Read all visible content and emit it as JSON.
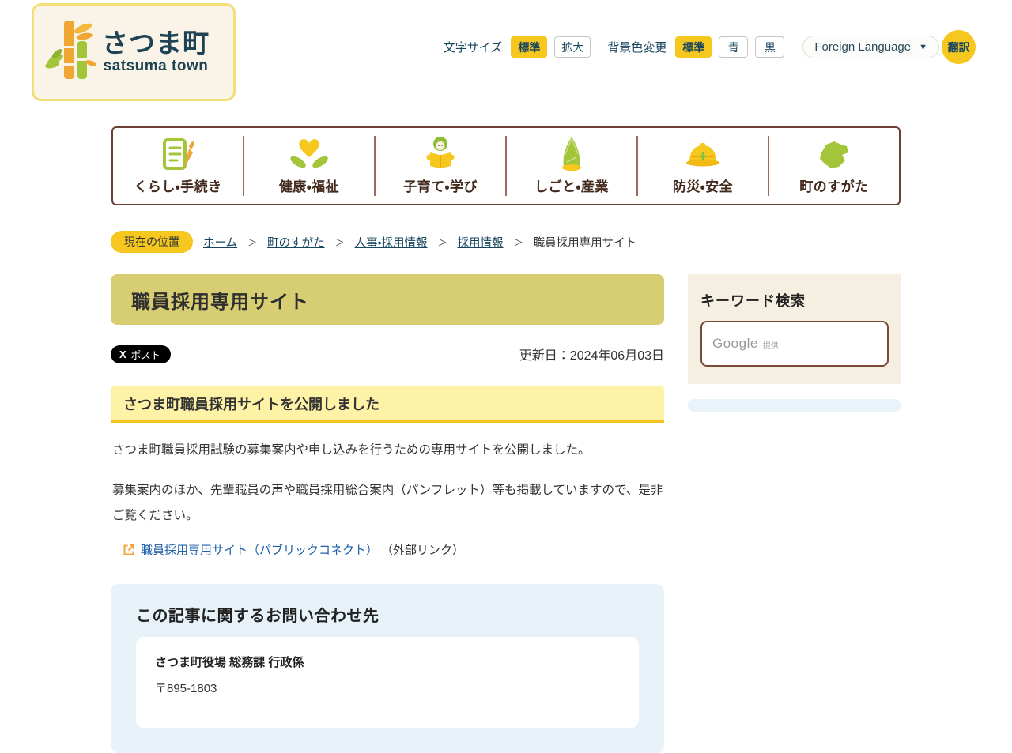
{
  "header": {
    "logo": {
      "title": "さつま町",
      "subtitle": "satsuma town"
    },
    "font_size": {
      "label": "文字サイズ",
      "options": [
        {
          "label": "標準",
          "active": true
        },
        {
          "label": "拡大",
          "active": false
        }
      ]
    },
    "bg_color": {
      "label": "背景色変更",
      "options": [
        {
          "label": "標準",
          "active": true
        },
        {
          "label": "青",
          "active": false
        },
        {
          "label": "黒",
          "active": false
        }
      ]
    },
    "language": {
      "label": "Foreign Language",
      "arrow": "▼",
      "translate": "翻訳"
    }
  },
  "nav": {
    "items": [
      {
        "label": "くらし・手続き",
        "icon": "document-pen-icon"
      },
      {
        "label": "健康・福祉",
        "icon": "heart-hands-icon"
      },
      {
        "label": "子育て・学び",
        "icon": "child-reading-icon"
      },
      {
        "label": "しごと・産業",
        "icon": "bamboo-shoot-icon"
      },
      {
        "label": "防災・安全",
        "icon": "helmet-icon"
      },
      {
        "label": "町のすがた",
        "icon": "town-map-icon"
      }
    ]
  },
  "breadcrumb": {
    "label": "現在の位置",
    "separator": "＞",
    "items": [
      {
        "text": "ホーム",
        "link": true
      },
      {
        "text": "町のすがた",
        "link": true
      },
      {
        "text": "人事・採用情報",
        "link": true
      },
      {
        "text": "採用情報",
        "link": true
      },
      {
        "text": "職員採用専用サイト",
        "link": false
      }
    ]
  },
  "page": {
    "title": "職員採用専用サイト",
    "share": {
      "icon_text": "X",
      "label": "ポスト"
    },
    "updated": "更新日：2024年06月03日"
  },
  "sidebar": {
    "search_title": "キーワード検索",
    "google": "Google",
    "provided": "提供"
  },
  "article": {
    "section_title": "さつま町職員採用サイトを公開しました",
    "paragraphs": [
      "さつま町職員採用試験の募集案内や申し込みを行うための専用サイトを公開しました。",
      "募集案内のほか、先輩職員の声や職員採用総合案内（パンフレット）等も掲載していますので、是非ご覧ください。"
    ],
    "link": {
      "text": "職員採用専用サイト（パブリックコネクト）",
      "suffix": "（外部リンク）"
    },
    "contact": {
      "title": "この記事に関するお問い合わせ先",
      "office": "さつま町役場 総務課 行政係",
      "postal": "〒895-1803"
    }
  },
  "colors": {
    "accent_yellow": "#f5c71f",
    "logo_border": "#f3de7a",
    "cream": "#f5efe2",
    "nav_border_brown": "#6e4032",
    "nav_text_brown": "#42291c",
    "green": "#a2c53a",
    "orange": "#f2a33c",
    "navy": "#17455e",
    "khaki_title": "#d7cd73",
    "section_yellow": "#fdf2a6",
    "section_gold": "#f2c21d",
    "link_blue": "#1d5fa8",
    "contact_blue": "#e8f3f9"
  }
}
